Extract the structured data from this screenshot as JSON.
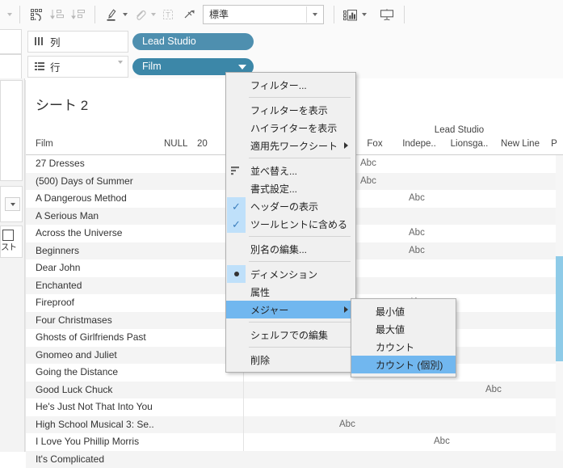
{
  "toolbar": {
    "buttons": [
      {
        "name": "swap-rows-cols-icon",
        "label": "",
        "disabled": false
      },
      {
        "name": "sort-ascending-icon",
        "label": "",
        "disabled": true
      },
      {
        "name": "sort-descending-icon",
        "label": "",
        "disabled": true
      },
      {
        "name": "highlighter-icon",
        "label": "",
        "disabled": false
      },
      {
        "name": "attachment-icon",
        "label": "",
        "disabled": true
      },
      {
        "name": "text-box-icon",
        "label": "",
        "disabled": true
      },
      {
        "name": "fixed-axis-icon",
        "label": "",
        "disabled": false
      }
    ],
    "fit_select": {
      "value": "標準"
    },
    "show_marks_label": "",
    "presentation_label": ""
  },
  "shelves": {
    "columns": {
      "label": "列",
      "field": "Lead Studio"
    },
    "rows": {
      "label": "行",
      "field": "Film"
    }
  },
  "left_rail": {
    "list_text": "スト"
  },
  "sheet": {
    "title": "シート 2",
    "row_header_label": "Film",
    "column_group_label": "Lead Studio",
    "null_headers": [
      "NULL",
      "20"
    ],
    "column_headers": [
      "Fox",
      "Indepe..",
      "Lionsga..",
      "New Line",
      "P"
    ],
    "rows": [
      {
        "film": "27 Dresses",
        "marks": [
          {
            "col": "Fox",
            "text": "Abc"
          }
        ]
      },
      {
        "film": "(500) Days of Summer",
        "marks": [
          {
            "col": "Fox",
            "text": "Abc"
          }
        ]
      },
      {
        "film": "A Dangerous Method",
        "marks": [
          {
            "col": "Lionsga..",
            "text": "Abc"
          }
        ]
      },
      {
        "film": "A Serious Man",
        "marks": []
      },
      {
        "film": "Across the Universe",
        "marks": [
          {
            "col": "Lionsga..",
            "text": "Abc"
          }
        ]
      },
      {
        "film": "Beginners",
        "marks": [
          {
            "col": "Lionsga..",
            "text": "Abc"
          }
        ]
      },
      {
        "film": "Dear John",
        "marks": []
      },
      {
        "film": "Enchanted",
        "marks": []
      },
      {
        "film": "Fireproof",
        "marks": [
          {
            "col": "Lionsga..",
            "text": "Abc"
          }
        ]
      },
      {
        "film": "Four Christmases",
        "marks": []
      },
      {
        "film": "Ghosts of Girlfriends Past",
        "marks": []
      },
      {
        "film": "Gnomeo and Juliet",
        "marks": []
      },
      {
        "film": "Going the Distance",
        "marks": []
      },
      {
        "film": "Good Luck Chuck",
        "marks": [
          {
            "col": "P",
            "text": "Abc"
          }
        ]
      },
      {
        "film": "He's Just Not That Into You",
        "marks": []
      },
      {
        "film": "High School Musical 3: Se..",
        "marks": [
          {
            "col": "Fox",
            "text": "Abc"
          }
        ]
      },
      {
        "film": "I Love You Phillip Morris",
        "marks": [
          {
            "col": "Lionsga..",
            "text": "Abc"
          }
        ]
      },
      {
        "film": "It's Complicated",
        "marks": []
      }
    ]
  },
  "context_menu": {
    "items": [
      {
        "label": "フィルター...",
        "kind": "item"
      },
      {
        "kind": "separator"
      },
      {
        "label": "フィルターを表示",
        "kind": "item"
      },
      {
        "label": "ハイライターを表示",
        "kind": "item"
      },
      {
        "label": "適用先ワークシート",
        "kind": "submenu"
      },
      {
        "kind": "separator"
      },
      {
        "label": "並べ替え...",
        "kind": "item",
        "icon": "sort-icon"
      },
      {
        "label": "書式設定...",
        "kind": "item"
      },
      {
        "label": "ヘッダーの表示",
        "kind": "checked"
      },
      {
        "label": "ツールヒントに含める",
        "kind": "checked"
      },
      {
        "kind": "separator"
      },
      {
        "label": "別名の編集...",
        "kind": "item"
      },
      {
        "kind": "separator"
      },
      {
        "label": "ディメンション",
        "kind": "radio-selected"
      },
      {
        "label": "属性",
        "kind": "item"
      },
      {
        "label": "メジャー",
        "kind": "submenu",
        "highlighted": true
      },
      {
        "kind": "separator"
      },
      {
        "label": "シェルフでの編集",
        "kind": "item"
      },
      {
        "kind": "separator"
      },
      {
        "label": "削除",
        "kind": "item"
      }
    ]
  },
  "submenu": {
    "items": [
      {
        "label": "最小値",
        "highlighted": false
      },
      {
        "label": "最大値",
        "highlighted": false
      },
      {
        "label": "カウント",
        "highlighted": false
      },
      {
        "label": "カウント (個別)",
        "highlighted": true
      }
    ]
  },
  "colors": {
    "pill": "#4e8faf",
    "pill_dark": "#3c87a8",
    "menu_highlight": "#71b7ef",
    "check_bg": "#bfe0fa",
    "scrollbar_thumb": "#8ecbe8"
  }
}
